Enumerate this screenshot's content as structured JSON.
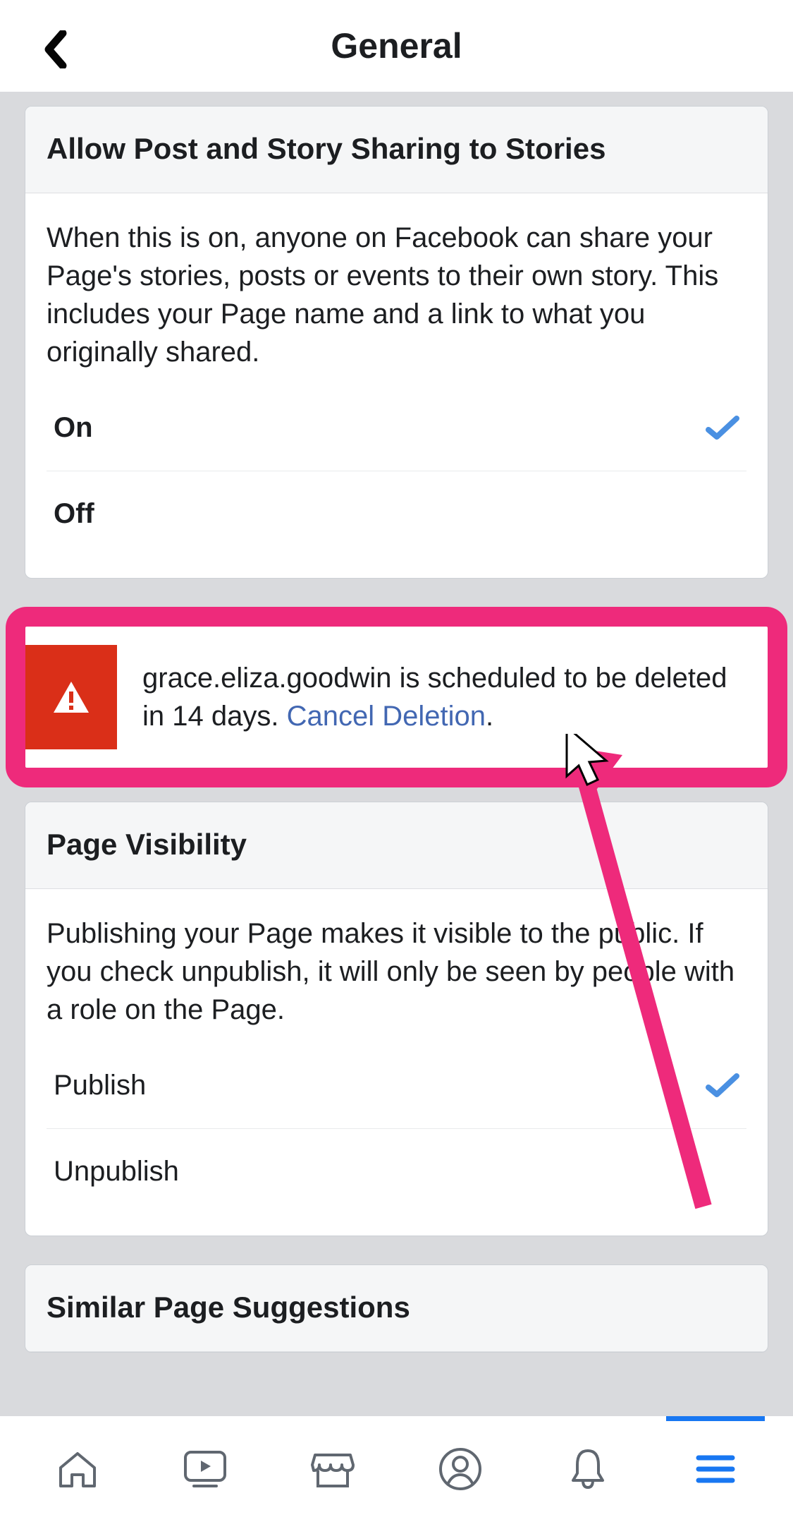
{
  "header": {
    "title": "General"
  },
  "sections": {
    "sharing": {
      "title": "Allow Post and Story Sharing to Stories",
      "description": "When this is on, anyone on Facebook can share your Page's stories, posts or events to their own story. This includes your Page name and a link to what you originally shared.",
      "options": {
        "on": "On",
        "off": "Off",
        "selected": "on"
      }
    },
    "deletion_alert": {
      "text_prefix": "grace.eliza.goodwin is scheduled to be deleted in 14 days. ",
      "link_text": "Cancel Deletion",
      "text_suffix": "."
    },
    "visibility": {
      "title": "Page Visibility",
      "description": "Publishing your Page makes it visible to the public. If you check unpublish, it will only be seen by people with a role on the Page.",
      "options": {
        "publish": "Publish",
        "unpublish": "Unpublish",
        "selected": "publish"
      }
    },
    "similar": {
      "title": "Similar Page Suggestions"
    }
  }
}
